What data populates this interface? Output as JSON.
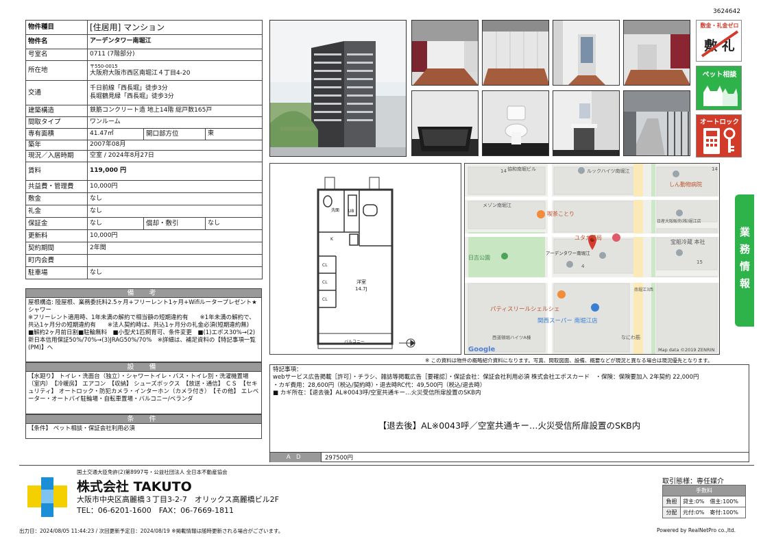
{
  "doc_id": "3624642",
  "spec": {
    "type_label": "物件種目",
    "type_value": "[住居用] マンション",
    "name_label": "物件名",
    "name_value": "アーデンタワー南堀江",
    "room_label": "号室名",
    "room_value": "0711 (7階部分)",
    "addr_label": "所在地",
    "addr_zip": "〒550-0015",
    "addr_value": "大阪府大阪市西区南堀江４丁目4-20",
    "access_label": "交通",
    "access_1": "千日前線「西長堀」徒歩3分",
    "access_2": "長堀鶴見緑「西長堀」徒歩3分",
    "struct_label": "建築構造",
    "struct_value": "鉄筋コンクリート造 地上14階 総戸数165戸",
    "layout_label": "間取タイプ",
    "layout_value": "ワンルーム",
    "area_label": "専有面積",
    "area_value": "41.47㎡",
    "dir_label": "開口部方位",
    "dir_value": "東",
    "built_label": "築年",
    "built_value": "2007年08月",
    "status_label": "現況／入居時期",
    "status_value": "空室 / 2024年8月27日",
    "rent_label": "賃料",
    "rent_value": "119,000 円",
    "fee_label": "共益費・管理費",
    "fee_value": "10,000円",
    "deposit_label": "敷金",
    "deposit_value": "なし",
    "key_label": "礼金",
    "key_value": "なし",
    "guarantee_label": "保証金",
    "guarantee_value": "なし",
    "amort_label": "償却・敷引",
    "amort_value": "なし",
    "renew_label": "更新料",
    "renew_value": "10,000円",
    "term_label": "契約期間",
    "term_value": "2年間",
    "town_label": "町内会費",
    "town_value": "",
    "parking_label": "駐車場",
    "parking_value": "なし"
  },
  "remarks": {
    "title": "備　考",
    "text": "屋根構造: 陸屋根、業務委託料2.5ヶ月+フリーレント1ヶ月+Wifiルータープレゼント★\nシャワー\n※フリーレント適用時、1年未満の解約で相当額の短期違約有　　※1年未満の解約で、共込1ヶ月分の短期違約有　　※法人契約時は、共込1ヶ月分の礼金必須(短期違約無)　■解約2ヶ月前日割■駐輪無料　■小型犬1匹飼育可、条件変更　■(1)エポス30%→(2)新日本信用保証50%/70%→(3)JRAG50%/70%　※詳細は、補足資料の【特記事項一覧(PM)】へ"
  },
  "facilities": {
    "title": "設　備",
    "text": "【水廻り】 トイレ・洗面台（独立）・シャワートイレ・バス・トイレ別・洗濯機置場（室内）　【冷暖房】 エアコン　【収納】 シューズボックス　【放送・通信】 ＣＳ　【セキュリティ】 オートロック・防犯カメラ・インターホン（カメラ付き）　【その他】 エレベーター・オートバイ駐輪場・自転車置場・バルコニー/ベランダ"
  },
  "conditions": {
    "title": "条　件",
    "text": "【条件】 ペット相談・保証会社利用必須"
  },
  "badges": {
    "b1_line1": "敷金・礼金ゼロ",
    "b1_main": "敷 礼",
    "b2": "ペット相談",
    "b3": "オートロック"
  },
  "sidetab": "業務情報",
  "floorplan": {
    "room_label": "洋室",
    "room_size": "14.7J",
    "balcony": "バルコニー",
    "wash": "洗面",
    "ub": "UB",
    "kitchen": "K",
    "cl": "CL"
  },
  "map": {
    "labels": [
      "協和南堀ビル",
      "ルックハイツ南堀江",
      "しん動物病院",
      "メゾン南堀江",
      "喫茶ことり",
      "日産大阪販売(株)堀江店",
      "ユタカ薬局",
      "宝船冷蔵 本社",
      "日吉公園",
      "アーデンタワー南堀江",
      "南堀江3西",
      "パティスリールシェルシェ",
      "関西スーパー 南堀江店",
      "西道頓堀ハイツA棟",
      "なにわ筋",
      "14",
      "14",
      "4",
      "15"
    ],
    "credit": "Map data ©2019 ZENRIN",
    "google": "Google"
  },
  "disclaimer": "※ この資料は物件の概略紹介資料になります。写真、間取図面、設備、概要などが現況と異なる場合は現況優先となります。",
  "notes": {
    "text": "特記事項：\nwebサービス広告掲載［許可］・チラシ、雑誌等掲載広告［要確認］・保証会社：保証会社利用必須 株式会社エポスカード　・保険：保険要加入 2年契約 22,000円\n・カギ費用：28,600円（税込/契約時）・退去時RC代：49,500円（税込/退去時）\n■ カギ所在：【退去後】AL※0043呼/空室共通キー…火災受信所扉設置のSKB内",
    "big": "【退去後】AL※0043呼／空室共通キー…火災受信所扉設置のSKB内",
    "ad_label": "ＡＤ",
    "ad_value": "297500円"
  },
  "footer": {
    "license": "国土交通大臣免許(2)第8997号・公益社団法人 全日本不動産協会",
    "company": "株式会社 TAKUTO",
    "address": "大阪市中央区高麗橋３丁目3-2-7　オリックス高麗橋ビル2F",
    "tel": "TEL：06-6201-1600　FAX：06-7669-1811",
    "mode": "取引態様：専任媒介",
    "fee_header": "手数料",
    "burden_label": "負担",
    "burden_value": "貸主:0%　借主:100%",
    "split_label": "分配",
    "split_value": "元付:0%　寄付:100%",
    "output": "出力日：2024/08/05 11:44:23 / 次回更新予定日：2024/08/19 ※掲載情報は随時更新される場合がございます。",
    "powered": "Powered by RealNetPro co.,ltd."
  },
  "colors": {
    "green": "#2db34a",
    "header_gray": "#999999",
    "logo_yellow": "#f5d000",
    "logo_blue": "#1a8fd8"
  }
}
